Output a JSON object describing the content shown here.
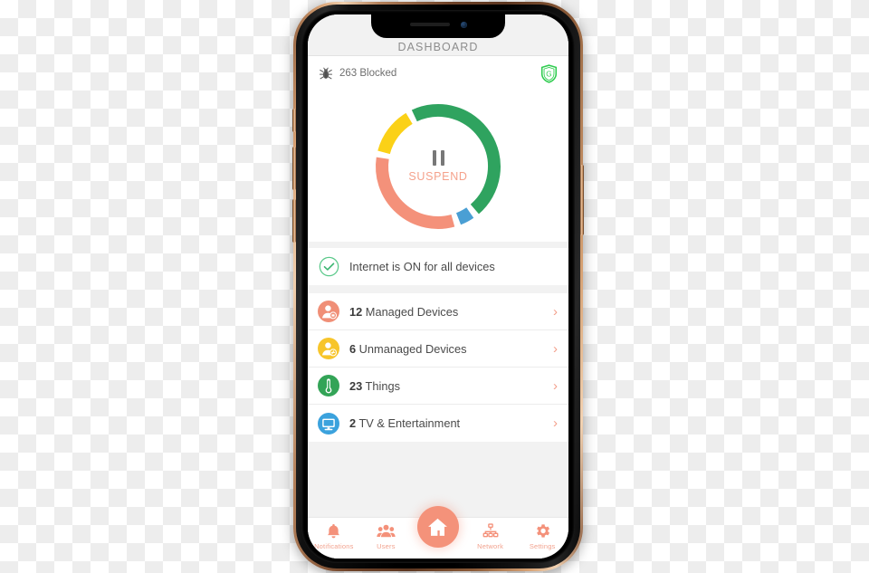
{
  "device": {
    "type": "smartphone-mockup",
    "buttons": [
      "mute-switch",
      "volume-up",
      "volume-down",
      "power-button"
    ]
  },
  "app": {
    "header": {
      "title": "DASHBOARD"
    },
    "status_strip": {
      "bug_icon": "bug-icon",
      "blocked_text": "263 Blocked",
      "shield_icon": "shield-g-icon",
      "shield_letter": "G"
    },
    "donut": {
      "center_icon": "pause-icon",
      "center_label": "SUSPEND"
    },
    "cards": [
      {
        "rows": [
          {
            "icon": "check-circle-icon",
            "label": "Internet is ON for all devices",
            "count": "",
            "chevron": false
          }
        ]
      },
      {
        "rows": [
          {
            "icon": "managed-user-icon",
            "count": "12",
            "label": " Managed Devices",
            "chevron": true
          },
          {
            "icon": "unmanaged-user-icon",
            "count": "6",
            "label": " Unmanaged Devices",
            "chevron": true
          },
          {
            "icon": "thermometer-icon",
            "count": "23",
            "label": " Things",
            "chevron": true
          },
          {
            "icon": "tv-monitor-icon",
            "count": "2",
            "label": " TV & Entertainment",
            "chevron": true
          }
        ]
      }
    ],
    "tabbar": [
      {
        "icon": "bell-icon",
        "label": "Notifications",
        "active": false
      },
      {
        "icon": "users-icon",
        "label": "Users",
        "active": false
      },
      {
        "icon": "home-icon",
        "label": "",
        "active": true
      },
      {
        "icon": "network-icon",
        "label": "Network",
        "active": false
      },
      {
        "icon": "gear-icon",
        "label": "Settings",
        "active": false
      }
    ],
    "chevron_glyph": "›"
  },
  "chart_data": {
    "type": "pie",
    "title": "Device bandwidth / status distribution",
    "render": "donut",
    "categories": [
      "Green",
      "Blue",
      "Salmon",
      "Yellow"
    ],
    "values": [
      44,
      5,
      31,
      13
    ],
    "colors": [
      "#2fa35f",
      "#4a9fd4",
      "#f4917a",
      "#fbd117"
    ],
    "gap_degrees": 6,
    "start_angle_deg": -118,
    "inner_radius_pct": 76,
    "legend": "none",
    "center_label": "SUSPEND"
  },
  "colors": {
    "accent": "#f4917a",
    "green": "#2fa35f",
    "blue": "#4a9fd4",
    "yellow": "#fbd117",
    "screen_bg": "#f2f2f2",
    "card_bg": "#ffffff",
    "text": "#4a4a4a",
    "muted": "#8d8d8d"
  }
}
